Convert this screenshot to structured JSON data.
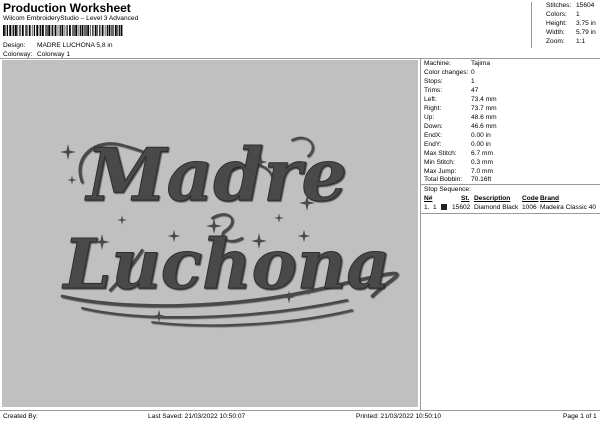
{
  "header": {
    "title": "Production Worksheet",
    "software": "Wilcom EmbroideryStudio – Level 3 Advanced",
    "design_label": "Design:",
    "design_value": "MADRE LUCHONA 5,8 in",
    "colorway_label": "Colorway:",
    "colorway_value": "Colorway 1"
  },
  "summary": {
    "rows": [
      {
        "label": "Stitches:",
        "value": "15604"
      },
      {
        "label": "Colors:",
        "value": "1"
      },
      {
        "label": "Height:",
        "value": "3.75 in"
      },
      {
        "label": "Width:",
        "value": "5.79 in"
      },
      {
        "label": "Zoom:",
        "value": "1:1"
      }
    ]
  },
  "design": {
    "line1": "Madre",
    "line2": "Luchona",
    "thread_color": "#4a4a4a",
    "background_color": "#c0c0c0"
  },
  "machine_info": {
    "rows": [
      {
        "label": "Machine:",
        "value": "Tajima"
      },
      {
        "label": "Color changes:",
        "value": "0"
      },
      {
        "label": "Stops:",
        "value": "1"
      },
      {
        "label": "Trims:",
        "value": "47"
      },
      {
        "label": "Left:",
        "value": "73.4 mm"
      },
      {
        "label": "Right:",
        "value": "73.7 mm"
      },
      {
        "label": "Up:",
        "value": "48.6 mm"
      },
      {
        "label": "Down:",
        "value": "46.6 mm"
      },
      {
        "label": "EndX:",
        "value": "0.00 in"
      },
      {
        "label": "EndY:",
        "value": "0.00 in"
      },
      {
        "label": "Max Stitch:",
        "value": "6.7 mm"
      },
      {
        "label": "Min Stitch:",
        "value": "0.3 mm"
      },
      {
        "label": "Max Jump:",
        "value": "7.0 mm"
      },
      {
        "label": "Total Bobbin:",
        "value": "70.16ft"
      }
    ]
  },
  "stop_sequence": {
    "title": "Stop Sequence:",
    "headers": {
      "n": "N#",
      "st": "St.",
      "description": "Description",
      "code": "Code",
      "brand": "Brand"
    },
    "row": {
      "index": "1.",
      "stop": "1",
      "stitches": "15602",
      "description": "Diamond Black",
      "code": "1006",
      "brand": "Madeira Classic 40",
      "swatch": "#222222"
    }
  },
  "footer": {
    "created_by": "Created By:",
    "last_saved": "Last Saved: 21/03/2022 10:50:07",
    "printed": "Printed: 21/03/2022 10:50:10",
    "page": "Page 1 of 1"
  }
}
